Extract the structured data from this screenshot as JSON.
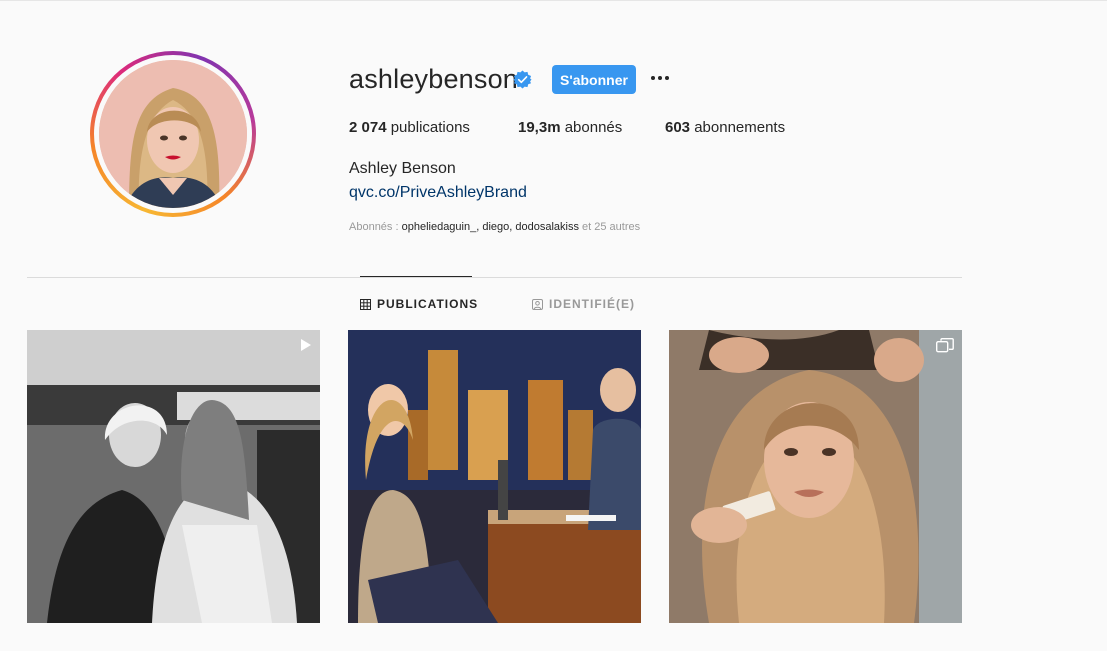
{
  "profile": {
    "username": "ashleybenson",
    "verified": true,
    "follow_label": "S'abonner",
    "more_icon": "ellipsis-icon",
    "stats": {
      "posts_value": "2 074",
      "posts_label": " publications",
      "followers_value": "19,3m",
      "followers_label": " abonnés",
      "following_value": "603",
      "following_label": " abonnements"
    },
    "full_name": "Ashley Benson",
    "link": "qvc.co/PriveAshleyBrand",
    "followed_by": {
      "prefix": "Abonnés : ",
      "names": "opheliedaguin_, diego, dodosalakiss",
      "suffix": " et 25 autres"
    }
  },
  "tabs": [
    {
      "label": "PUBLICATIONS",
      "icon": "grid-icon",
      "active": true
    },
    {
      "label": "IDENTIFIÉ(E)",
      "icon": "tagged-icon",
      "active": false
    }
  ],
  "posts": [
    {
      "badge": "video-icon"
    },
    {
      "badge": null
    },
    {
      "badge": "carousel-icon"
    }
  ],
  "colors": {
    "accent": "#3897f0",
    "link": "#003569",
    "muted": "#999999",
    "verified_badge": "#3897f0"
  }
}
